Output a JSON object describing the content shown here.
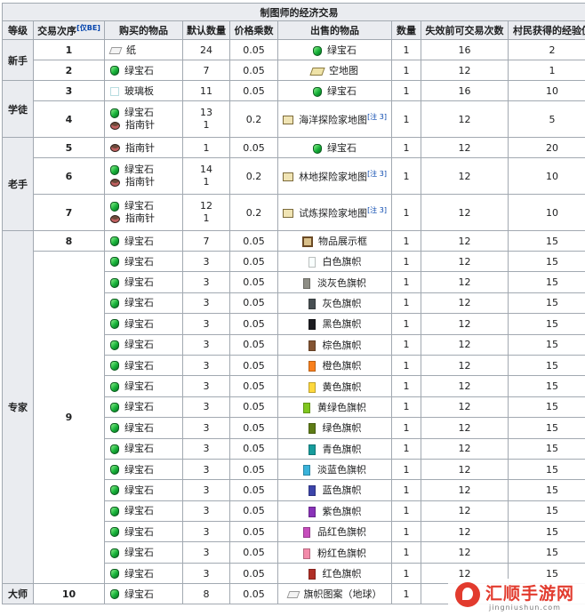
{
  "caption": "制图师的经济交易",
  "headers": {
    "level": "等级",
    "seq": "交易次序",
    "seq_note": "[仅BE]",
    "buy": "购买的物品",
    "default_qty": "默认数量",
    "price_mult": "价格乘数",
    "sell": "出售的物品",
    "qty": "数量",
    "max_uses": "失效前可交易次数",
    "xp": "村民获得的经验值"
  },
  "levels": [
    "新手",
    "学徒",
    "老手",
    "专家",
    "大师"
  ],
  "sequences": [
    "1",
    "2",
    "3",
    "4",
    "5",
    "6",
    "7",
    "8",
    "9",
    "10"
  ],
  "items": {
    "emerald": "绿宝石",
    "paper": "纸",
    "glass_pane": "玻璃板",
    "compass": "指南针",
    "empty_map": "空地图",
    "ocean_map": "海洋探险家地图",
    "woodland_map": "林地探险家地图",
    "trial_map": "试炼探险家地图",
    "item_frame": "物品展示框",
    "banner_pattern": "旗帜图案（地球）"
  },
  "note": "[注 3]",
  "banners": [
    {
      "name": "白色旗帜",
      "color": "#f9fffe"
    },
    {
      "name": "淡灰色旗帜",
      "color": "#8e8e86"
    },
    {
      "name": "灰色旗帜",
      "color": "#474f52"
    },
    {
      "name": "黑色旗帜",
      "color": "#1d1d21"
    },
    {
      "name": "棕色旗帜",
      "color": "#835432"
    },
    {
      "name": "橙色旗帜",
      "color": "#f9801d"
    },
    {
      "name": "黄色旗帜",
      "color": "#fed83d"
    },
    {
      "name": "黄绿色旗帜",
      "color": "#80c71f"
    },
    {
      "name": "绿色旗帜",
      "color": "#5e7c16"
    },
    {
      "name": "青色旗帜",
      "color": "#169c9c"
    },
    {
      "name": "淡蓝色旗帜",
      "color": "#3ab3da"
    },
    {
      "name": "蓝色旗帜",
      "color": "#3c44aa"
    },
    {
      "name": "紫色旗帜",
      "color": "#8932b8"
    },
    {
      "name": "品红色旗帜",
      "color": "#c74ebd"
    },
    {
      "name": "粉红色旗帜",
      "color": "#f38baa"
    },
    {
      "name": "红色旗帜",
      "color": "#b02e26"
    }
  ],
  "rows": {
    "r1": {
      "qty": "24",
      "mult": "0.05",
      "sq": "1",
      "uses": "16",
      "xp": "2"
    },
    "r2": {
      "qty": "7",
      "mult": "0.05",
      "sq": "1",
      "uses": "12",
      "xp": "1"
    },
    "r3": {
      "qty": "11",
      "mult": "0.05",
      "sq": "1",
      "uses": "16",
      "xp": "10"
    },
    "r4": {
      "qty_a": "13",
      "qty_b": "1",
      "mult": "0.2",
      "sq": "1",
      "uses": "12",
      "xp": "5"
    },
    "r5": {
      "qty": "1",
      "mult": "0.05",
      "sq": "1",
      "uses": "12",
      "xp": "20"
    },
    "r6": {
      "qty_a": "14",
      "qty_b": "1",
      "mult": "0.2",
      "sq": "1",
      "uses": "12",
      "xp": "10"
    },
    "r7": {
      "qty_a": "12",
      "qty_b": "1",
      "mult": "0.2",
      "sq": "1",
      "uses": "12",
      "xp": "10"
    },
    "r8": {
      "qty": "7",
      "mult": "0.05",
      "sq": "1",
      "uses": "12",
      "xp": "15"
    },
    "r9": {
      "qty": "3",
      "mult": "0.05",
      "sq": "1",
      "uses": "12",
      "xp": "15"
    },
    "r10": {
      "qty": "8",
      "mult": "0.05",
      "sq": "1",
      "uses": "12",
      "xp": "15"
    }
  },
  "watermark": {
    "title": "汇顺手游网",
    "url": "jingniushun.com"
  }
}
